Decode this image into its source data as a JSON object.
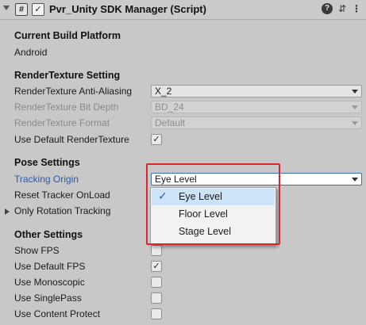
{
  "header": {
    "title": "Pvr_Unity SDK Manager (Script)",
    "script_icon_glyph": "#",
    "enabled_check": "✓",
    "help_glyph": "?",
    "preset_glyph": "⇵",
    "menu_glyph": "⋮"
  },
  "build": {
    "section": "Current Build Platform",
    "platform": "Android"
  },
  "render_texture": {
    "section": "RenderTexture Setting",
    "anti_aliasing_label": "RenderTexture Anti-Aliasing",
    "anti_aliasing_value": "X_2",
    "bit_depth_label": "RenderTexture Bit Depth",
    "bit_depth_value": "BD_24",
    "format_label": "RenderTexture Format",
    "format_value": "Default",
    "use_default_label": "Use Default RenderTexture",
    "use_default_check": "✓"
  },
  "pose": {
    "section": "Pose Settings",
    "tracking_origin_label": "Tracking Origin",
    "tracking_origin_value": "Eye Level",
    "reset_tracker_label": "Reset Tracker OnLoad",
    "rotation_only_label": "Only Rotation Tracking"
  },
  "dropdown": {
    "items": [
      "Eye Level",
      "Floor Level",
      "Stage Level"
    ],
    "selected_tick": "✓"
  },
  "other": {
    "section": "Other Settings",
    "show_fps_label": "Show FPS",
    "use_default_fps_label": "Use Default FPS",
    "use_default_fps_check": "✓",
    "use_monoscopic_label": "Use Monoscopic",
    "use_singlepass_label": "Use SinglePass",
    "use_content_protect_label": "Use Content Protect"
  },
  "colors": {
    "highlight_box": "#e0242d",
    "link_label": "#2a5aa8",
    "dropdown_selected": "#cde3f7"
  }
}
